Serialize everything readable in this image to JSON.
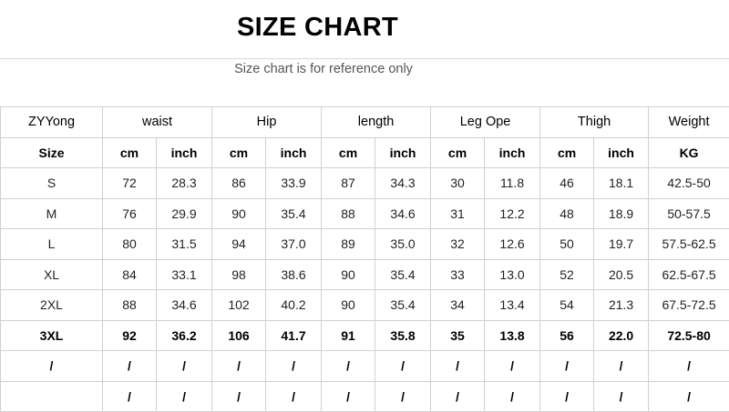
{
  "title": "SIZE CHART",
  "subtitle": "Size chart is for reference only",
  "table": {
    "header": [
      "ZYYong",
      "waist",
      "Hip",
      "length",
      "Leg Ope",
      "Thigh",
      "Weight"
    ],
    "subheader": [
      "Size",
      "cm",
      "inch",
      "cm",
      "inch",
      "cm",
      "inch",
      "cm",
      "inch",
      "cm",
      "inch",
      "KG"
    ],
    "rows": [
      [
        "S",
        "72",
        "28.3",
        "86",
        "33.9",
        "87",
        "34.3",
        "30",
        "11.8",
        "46",
        "18.1",
        "42.5-50"
      ],
      [
        "M",
        "76",
        "29.9",
        "90",
        "35.4",
        "88",
        "34.6",
        "31",
        "12.2",
        "48",
        "18.9",
        "50-57.5"
      ],
      [
        "L",
        "80",
        "31.5",
        "94",
        "37.0",
        "89",
        "35.0",
        "32",
        "12.6",
        "50",
        "19.7",
        "57.5-62.5"
      ],
      [
        "XL",
        "84",
        "33.1",
        "98",
        "38.6",
        "90",
        "35.4",
        "33",
        "13.0",
        "52",
        "20.5",
        "62.5-67.5"
      ],
      [
        "2XL",
        "88",
        "34.6",
        "102",
        "40.2",
        "90",
        "35.4",
        "34",
        "13.4",
        "54",
        "21.3",
        "67.5-72.5"
      ],
      [
        "3XL",
        "92",
        "36.2",
        "106",
        "41.7",
        "91",
        "35.8",
        "35",
        "13.8",
        "56",
        "22.0",
        "72.5-80"
      ],
      [
        "/",
        "/",
        "/",
        "/",
        "/",
        "/",
        "/",
        "/",
        "/",
        "/",
        "/",
        "/"
      ],
      [
        "",
        "/",
        "/",
        "/",
        "/",
        "/",
        "/",
        "/",
        "/",
        "/",
        "/",
        "/"
      ]
    ]
  }
}
